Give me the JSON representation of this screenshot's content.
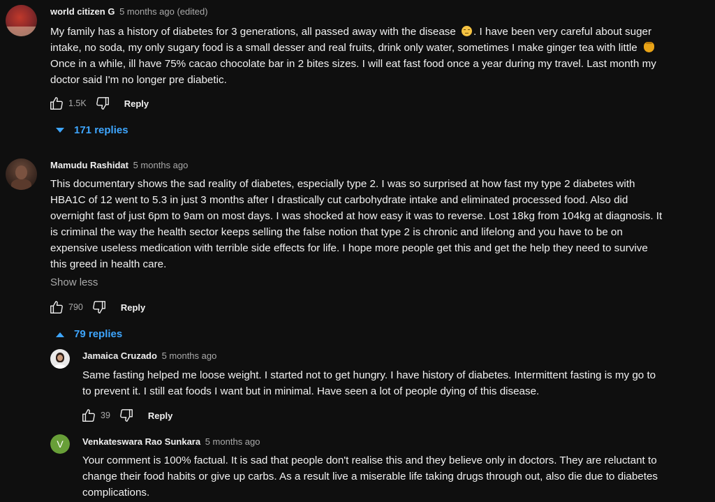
{
  "comments": [
    {
      "author": "world citizen G",
      "time": "5 months ago (edited)",
      "lines": [
        "My family has a history of diabetes for 3 generations, all passed away with the disease",
        ". I have been very careful about suger",
        "intake,  no soda, my only sugary food is a small desser and real fruits, drink only water,  sometimes I make ginger tea with little",
        "Once in a while, ill have 75% cacao chocolate bar in 2 bites sizes. I will eat fast food once a year during my travel. Last month my",
        "doctor said I'm no longer pre diabetic."
      ],
      "emoji_1": "pensive-face-emoji",
      "emoji_2": "honey-pot-emoji",
      "likes": "1.5K",
      "reply_label": "Reply",
      "replies_label": "171 replies"
    },
    {
      "author": "Mamudu Rashidat",
      "time": "5 months ago",
      "lines": [
        "This documentary shows the sad reality of diabetes, especially type 2. I was so surprised at how fast my type 2 diabetes with",
        "HBA1C of 12 went to 5.3 in just 3 months after I drastically cut carbohydrate intake and eliminated processed food. Also did",
        "overnight fast of just 6pm to 9am on most days. I was shocked at how easy it was to reverse. Lost 18kg from 104kg at diagnosis. It",
        "is criminal the way the health sector keeps selling the false notion that type 2 is chronic and lifelong and you have to be on",
        "expensive useless medication with terrible side effects for life. I hope more people get this and get the help they need to survive",
        "this greed in health care."
      ],
      "show_less": "Show less",
      "likes": "790",
      "reply_label": "Reply",
      "replies_label": "79 replies"
    }
  ],
  "replies": [
    {
      "author": "Jamaica Cruzado",
      "time": "5 months ago",
      "lines": [
        "Same fasting helped me loose weight. I started not to get hungry. I have history of diabetes. Intermittent fasting is my go to",
        "to prevent it. I still eat foods I want but in minimal. Have seen a lot of people dying of this disease."
      ],
      "likes": "39",
      "reply_label": "Reply"
    },
    {
      "author": "Venkateswara Rao Sunkara",
      "time": "5 months ago",
      "avatar_letter": "V",
      "avatar_color": "#689f38",
      "lines": [
        "Your comment is 100% factual. It is sad that people don't realise this and they believe only in doctors. They are reluctant to",
        "change their food habits or give up carbs. As a result  live a  miserable life taking drugs through out, also die due to diabetes",
        "complications."
      ]
    }
  ],
  "colors": {
    "background": "#0f0f0f",
    "text": "#f1f1f1",
    "secondary_text": "#aaaaaa",
    "link_blue": "#3ea6ff"
  }
}
